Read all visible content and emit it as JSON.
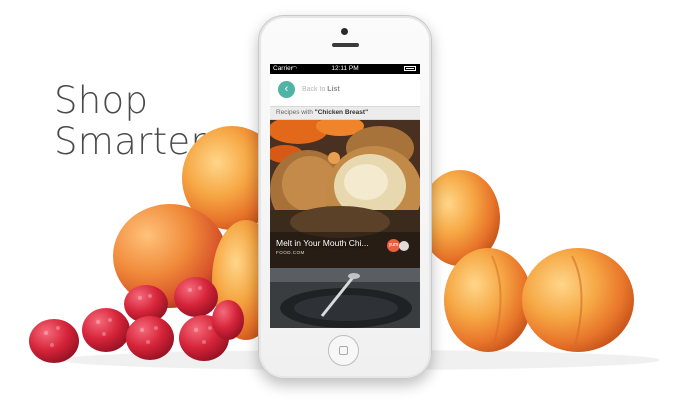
{
  "headline": {
    "line1": "Shop",
    "line2": "Smarter"
  },
  "status_bar": {
    "carrier": "Carrier",
    "time": "12:11 PM"
  },
  "nav": {
    "back_prefix": "Back to ",
    "back_target": "List"
  },
  "recipes_header": {
    "prefix": "Recipes with ",
    "ingredient": "\"Chicken Breast\""
  },
  "cards": [
    {
      "title": "Melt in Your Mouth Chi...",
      "source": "FOOD.COM",
      "badge": "yum"
    }
  ],
  "colors": {
    "accent": "#4fb3a6",
    "badge": "#e8603c",
    "headline": "#4a4a4a"
  },
  "icons": [
    "back-arrow-icon",
    "wifi-icon",
    "battery-icon",
    "yum-badge-icon",
    "heart-icon"
  ]
}
